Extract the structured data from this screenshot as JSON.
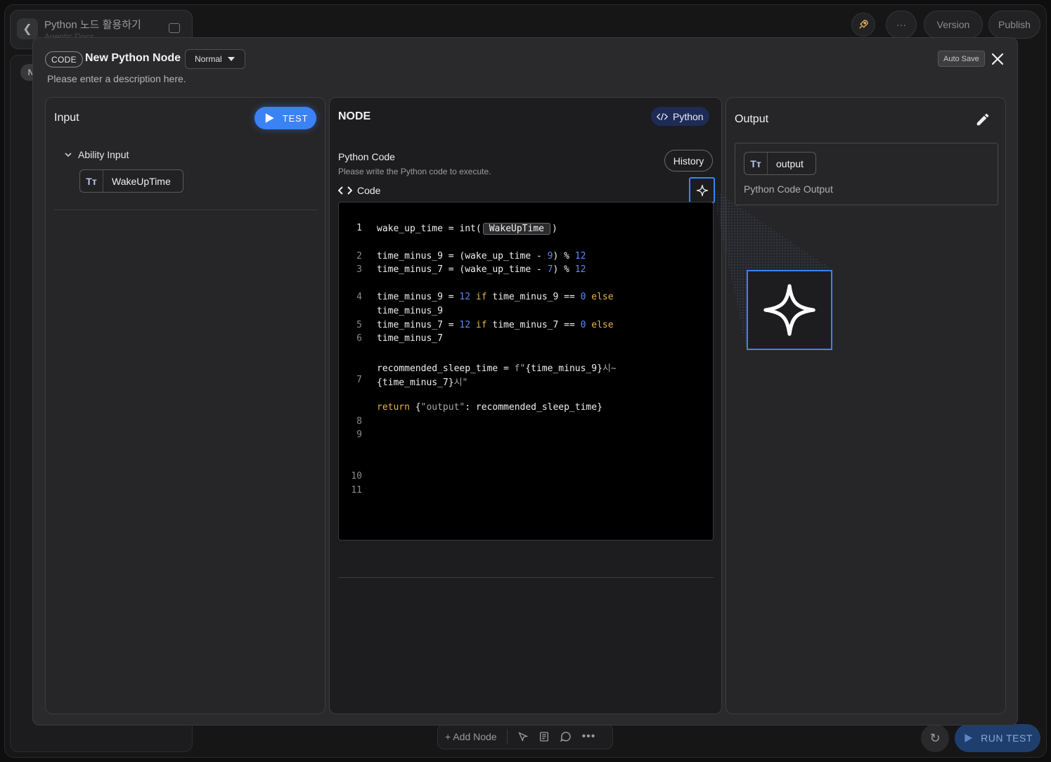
{
  "app": {
    "title": "Python 노드 활용하기",
    "subtitle": "Agentic Docs",
    "left_tab_label": "N",
    "top_buttons": {
      "more": "···",
      "version": "Version",
      "publish": "Publish"
    },
    "bottom_bar": {
      "add_node": "+ Add Node",
      "run_test": "RUN TEST"
    }
  },
  "modal": {
    "type_badge": "CODE",
    "title": "New Python Node",
    "mode": "Normal",
    "description": "Please enter a description here.",
    "auto_save": "Auto Save"
  },
  "input_panel": {
    "title": "Input",
    "test_button": "TEST",
    "group_label": "Ability Input",
    "variables": [
      {
        "type_icon": "Tт",
        "name": "WakeUpTime"
      }
    ]
  },
  "node_panel": {
    "title": "NODE",
    "language": "Python",
    "field_label": "Python Code",
    "field_help": "Please write the Python code to execute.",
    "history_button": "History",
    "code_label": "Code",
    "line_numbers": [
      "1",
      "2",
      "3",
      "4",
      "5",
      "6",
      "7",
      "8",
      "9",
      "10",
      "11"
    ],
    "code": {
      "l1_a": "wake_up_time = int(",
      "l1_var": "WakeUpTime",
      "l1_b": ")",
      "l2_a": "time_minus_9 = (wake_up_time - ",
      "l2_n1": "9",
      "l2_b": ") % ",
      "l2_n2": "12",
      "l3_a": "time_minus_7 = (wake_up_time - ",
      "l3_n1": "7",
      "l3_b": ") % ",
      "l3_n2": "12",
      "l4_a": "time_minus_9 = ",
      "l4_n1": "12",
      "l4_if": "if",
      "l4_b": " time_minus_9 == ",
      "l4_n2": "0",
      "l4_else": "else",
      "l4_c": "time_minus_9",
      "l5_a": "time_minus_7 = ",
      "l5_n1": "12",
      "l5_if": "if",
      "l5_b": " time_minus_7 == ",
      "l5_n2": "0",
      "l5_else": "else",
      "l5_c": "time_minus_7",
      "l7_a": "recommended_sleep_time = ",
      "l7_s1": "f\"",
      "l7_b": "{time_minus_9}",
      "l7_s2": "시~",
      "l7_c": "{time_minus_7}",
      "l7_s3": "시\"",
      "l8_ret": "return",
      "l8_a": " {",
      "l8_s": "\"output\"",
      "l8_b": ": recommended_sleep_time}"
    }
  },
  "output_panel": {
    "title": "Output",
    "outputs": [
      {
        "type_icon": "Tт",
        "name": "output",
        "description": "Python Code Output"
      }
    ]
  },
  "colors": {
    "accent": "#3b82f6",
    "number": "#5a8bf0",
    "keyword": "#e9b24a",
    "modal_bg": "#2a2a2c",
    "code_bg": "#000000"
  },
  "icons": [
    "chevron-left-icon",
    "sidebar-toggle-icon",
    "rocket-icon",
    "close-icon",
    "play-icon",
    "chevron-down-icon",
    "text-type-icon",
    "code-brackets-icon",
    "sparkle-icon",
    "pencil-icon",
    "cursor-icon",
    "note-icon",
    "comment-icon",
    "refresh-icon"
  ]
}
